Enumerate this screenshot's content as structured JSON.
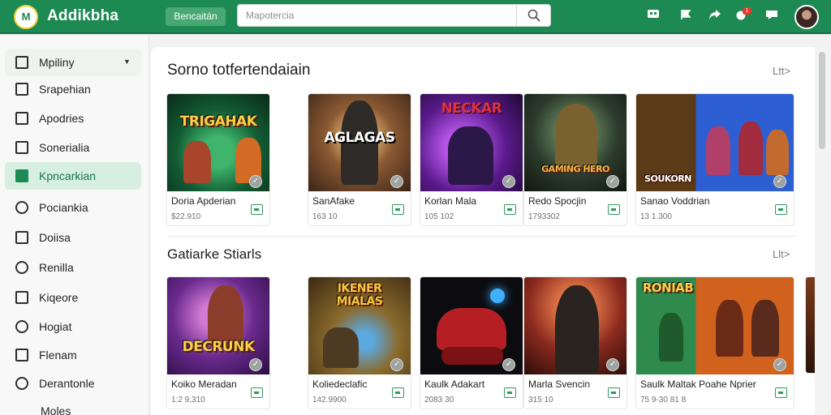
{
  "app": {
    "title": "Addikbha",
    "logo_text": "M"
  },
  "topbar": {
    "button_label": "Bencaitán",
    "search_placeholder": "Mapotercia",
    "icons": [
      "monitor-icon",
      "flag-icon",
      "share-icon",
      "notification-icon",
      "message-icon"
    ],
    "notification_count": "1"
  },
  "sidebar": {
    "items": [
      {
        "label": "Mpiliny",
        "icon": "square-icon"
      },
      {
        "label": "Srapehian",
        "icon": "grid-icon"
      },
      {
        "label": "Apodries",
        "icon": "checkbox-icon"
      },
      {
        "label": "Sonerialia",
        "icon": "image-icon"
      },
      {
        "label": "Kpncarkian",
        "icon": "controller-icon"
      },
      {
        "label": "Pociankia",
        "icon": "heart-icon"
      },
      {
        "label": "Doiisa",
        "icon": "grid-icon"
      },
      {
        "label": "Renilla",
        "icon": "settings-icon"
      },
      {
        "label": "Kiqeore",
        "icon": "image-icon"
      },
      {
        "label": "Hogiat",
        "icon": "user-icon"
      },
      {
        "label": "Flenam",
        "icon": "square-icon"
      },
      {
        "label": "Derantonle",
        "icon": "chat-icon"
      },
      {
        "label": "Moles",
        "icon": ""
      }
    ]
  },
  "sections": [
    {
      "title": "Sorno totfertendaiain",
      "link": "Ltt>",
      "cards": [
        {
          "cover": "TRIGAHAK",
          "name": "Doria Apderian",
          "sub": "$22.910"
        },
        {
          "cover": "AGLAGAS",
          "name": "SanAfake",
          "sub": "163 10"
        },
        {
          "cover": "NECKAR",
          "name": "Korlan Mala",
          "sub": "105 102"
        },
        {
          "cover": "GAMING HERO",
          "name": "Redo Spocjin",
          "sub": "1793302"
        },
        {
          "cover": "SOUKORN",
          "name": "Sanao Voddrian",
          "sub": "13 1.300"
        }
      ]
    },
    {
      "title": "Gatiarke Stiarls",
      "link": "Llt>",
      "cards": [
        {
          "cover": "DECRUNK",
          "name": "Koiko Meradan",
          "sub": "1:2 9,310"
        },
        {
          "cover": "IKENER MIALAS",
          "name": "Koliedeclafic",
          "sub": "142.9900"
        },
        {
          "cover": "",
          "name": "Kaulk Adakart",
          "sub": "2083 30"
        },
        {
          "cover": "",
          "name": "Marla Svencin",
          "sub": "315 10"
        },
        {
          "cover": "RONIAB",
          "name": "Saulk Maltak   Poahe Nprier",
          "sub": "75 9-30 81 8"
        }
      ]
    }
  ]
}
